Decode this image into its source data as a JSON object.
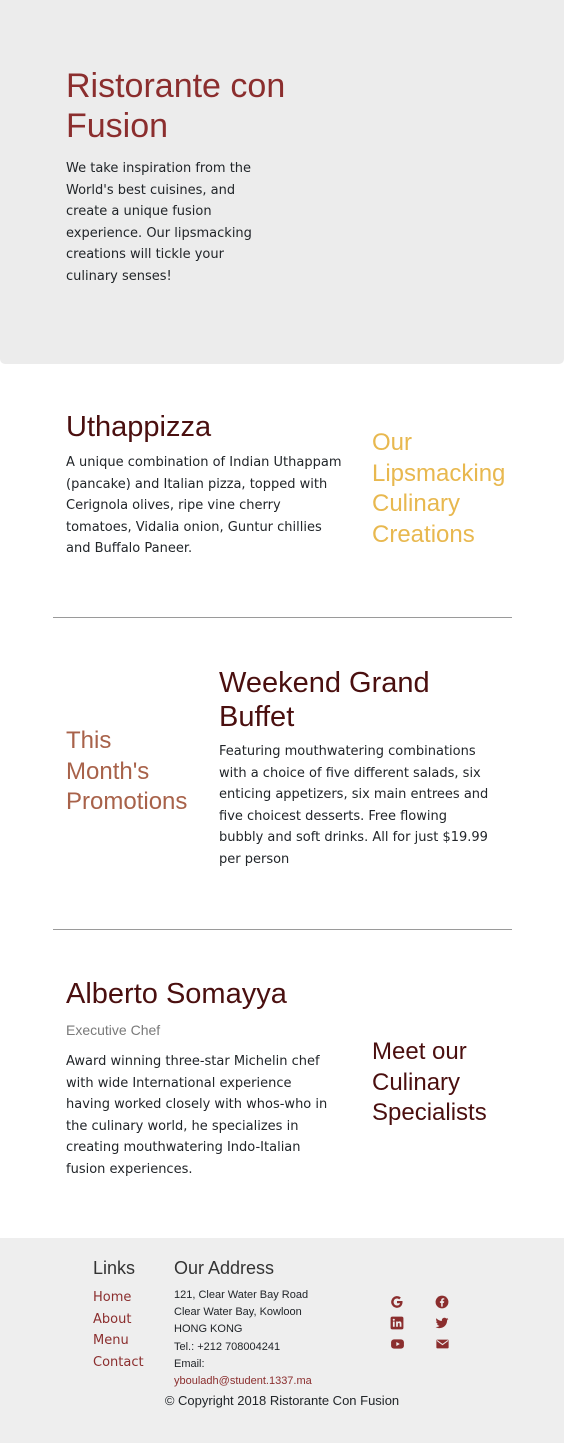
{
  "jumbotron": {
    "title": "Ristorante con Fusion",
    "text": "We take inspiration from the World's best cuisines, and create a unique fusion experience. Our lipsmacking creations will tickle your culinary senses!"
  },
  "featured_dish": {
    "name": "Uthappizza",
    "description": "A unique combination of Indian Uthappam (pancake) and Italian pizza, topped with Cerignola olives, ripe vine cherry tomatoes, Vidalia onion, Guntur chillies and Buffalo Paneer.",
    "side_heading": "Our Lipsmacking Culinary Creations"
  },
  "promotion": {
    "side_heading": "This Month's Promotions",
    "name": "Weekend Grand Buffet",
    "description": "Featuring mouthwatering combinations with a choice of five different salads, six enticing appetizers, six main entrees and five choicest desserts. Free flowing bubbly and soft drinks. All for just $19.99 per person"
  },
  "leader": {
    "name": "Alberto Somayya",
    "designation": "Executive Chef",
    "description": "Award winning three-star Michelin chef with wide International experience having worked closely with whos-who in the culinary world, he specializes in creating mouthwatering Indo-Italian fusion experiences.",
    "side_heading": "Meet our Culinary Specialists"
  },
  "footer": {
    "links_heading": "Links",
    "links": [
      "Home",
      "About",
      "Menu",
      "Contact"
    ],
    "address_heading": "Our Address",
    "address_lines": [
      "121, Clear Water Bay Road",
      "Clear Water Bay, Kowloon",
      "HONG KONG"
    ],
    "tel": "Tel.: +212 708004241",
    "email_label": "Email:",
    "email": "ybouladh@student.1337.ma",
    "social_icons": [
      "google-icon",
      "facebook-icon",
      "linkedin-icon",
      "twitter-icon",
      "youtube-icon",
      "mail-icon"
    ],
    "copyright": "© Copyright 2018 Ristorante Con Fusion"
  },
  "colors": {
    "brand": "#8b2e2e",
    "heading_dark": "#4a0f0f",
    "gold": "#e8b84f",
    "promo_brown": "#a8624a",
    "jumbotron_bg": "#ececec",
    "footer_bg": "#eeeeee"
  }
}
